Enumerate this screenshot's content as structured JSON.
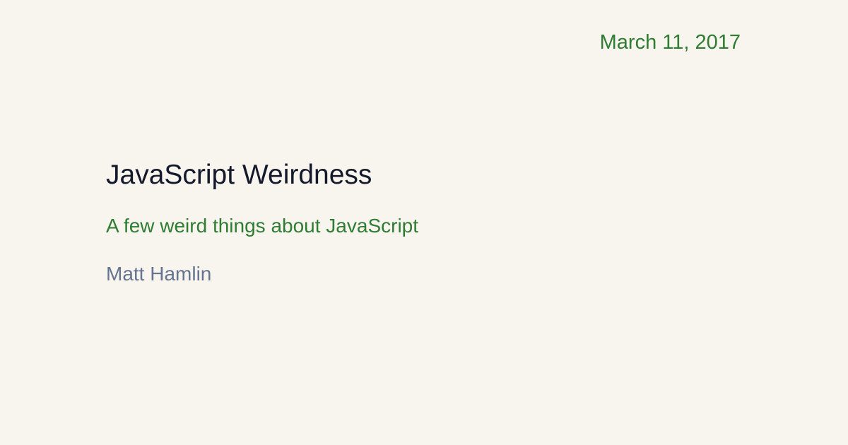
{
  "post": {
    "date": "March 11, 2017",
    "title": "JavaScript Weirdness",
    "subtitle": "A few weird things about JavaScript",
    "author": "Matt Hamlin"
  },
  "colors": {
    "background": "#f8f4ee",
    "title": "#141a2b",
    "accent": "#2e7d32",
    "author": "#66758f"
  }
}
